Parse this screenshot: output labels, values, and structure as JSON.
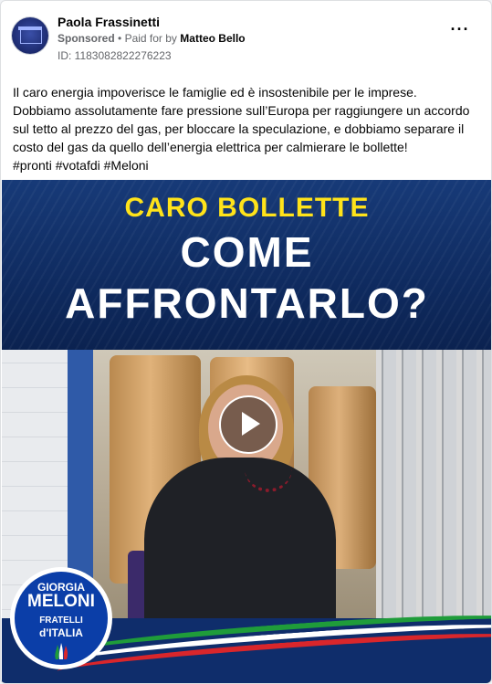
{
  "post": {
    "page_name": "Paola Frassinetti",
    "sponsored_label": "Sponsored",
    "separator": "•",
    "paid_for_prefix": "Paid for by",
    "paid_for_name": "Matteo Bello",
    "ad_id": "ID: 1183082822276223",
    "more_label": "···",
    "body_lines": [
      "Il caro energia impoverisce le famiglie ed è insostenibile per le imprese.",
      "Dobbiamo assolutamente fare pressione sull’Europa per raggiungere un accordo sul tetto al prezzo del gas, per bloccare la speculazione, e dobbiamo separare il costo del gas da quello dell’energia elettrica per calmierare le bollette!",
      "#pronti #votafdi #Meloni"
    ]
  },
  "video": {
    "headline_line1": "CARO BOLLETTE",
    "headline_line2": "COME",
    "headline_line3": "AFFRONTARLO?",
    "play_icon": "play-icon",
    "logo": {
      "line1": "GIORGIA",
      "line2": "MELONI",
      "line3": "FRATELLI",
      "line4": "d'ITALIA"
    }
  },
  "colors": {
    "headline_yellow": "#ffe31a",
    "banner_blue": "#173a78",
    "logo_blue": "#0b3ea8",
    "flag_green": "#1f9c3a",
    "flag_red": "#d9262b"
  }
}
